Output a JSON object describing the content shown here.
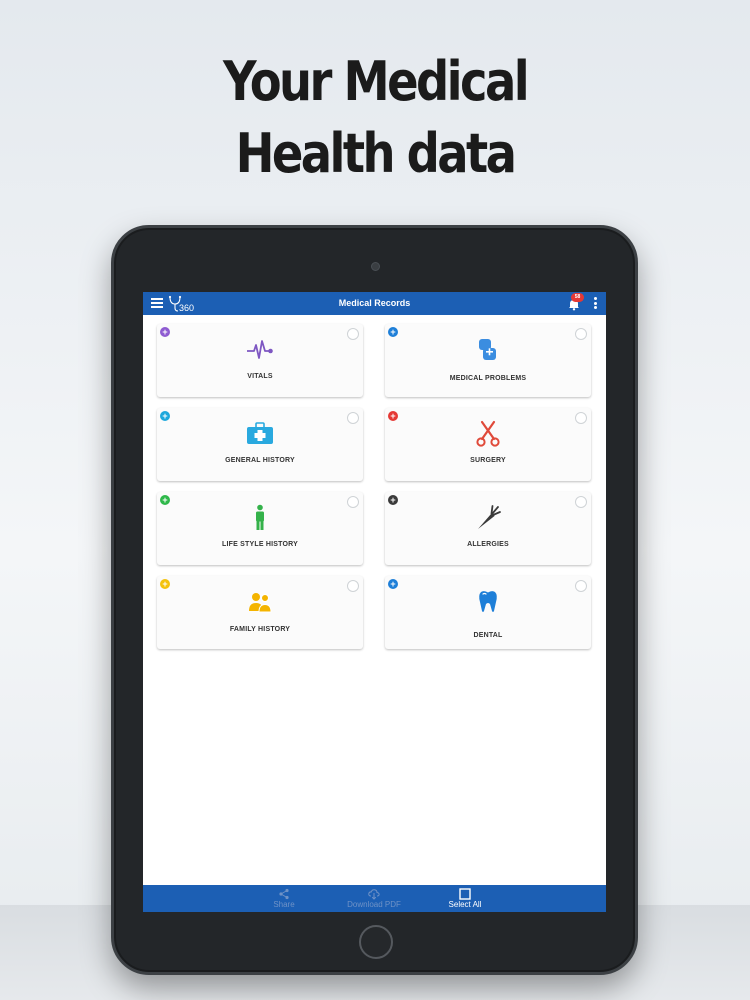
{
  "headline": {
    "line1": "Your Medical",
    "line2": "Health data"
  },
  "appbar": {
    "title": "Medical Records",
    "notification_count": "58",
    "menu_icon": "hamburger-menu-icon",
    "logo_text": "360"
  },
  "cards": [
    {
      "label": "VITALS",
      "icon": "heartbeat-icon",
      "badge_color": "#8e5bd1",
      "icon_color": "#7e57c2"
    },
    {
      "label": "MEDICAL PROBLEMS",
      "icon": "medical-problems-icon",
      "badge_color": "#1e7fd8",
      "icon_color": "#3b8de0"
    },
    {
      "label": "GENERAL HISTORY",
      "icon": "first-aid-kit-icon",
      "badge_color": "#1ea8dc",
      "icon_color": "#29a9df"
    },
    {
      "label": "SURGERY",
      "icon": "scissors-icon",
      "badge_color": "#e53935",
      "icon_color": "#e04a3a"
    },
    {
      "label": "LIFE STYLE HISTORY",
      "icon": "person-icon",
      "badge_color": "#2fb84a",
      "icon_color": "#34b24a"
    },
    {
      "label": "ALLERGIES",
      "icon": "carrot-icon",
      "badge_color": "#3a3a3a",
      "icon_color": "#3a3a3a"
    },
    {
      "label": "FAMILY HISTORY",
      "icon": "family-icon",
      "badge_color": "#f4c20d",
      "icon_color": "#f4b400"
    },
    {
      "label": "DENTAL",
      "icon": "tooth-icon",
      "badge_color": "#1e7fd8",
      "icon_color": "#1e7fd8"
    }
  ],
  "bottom_bar": {
    "share_label": "Share",
    "download_label": "Download PDF",
    "select_all_label": "Select All"
  },
  "colors": {
    "brand_blue": "#1c5fb4"
  }
}
